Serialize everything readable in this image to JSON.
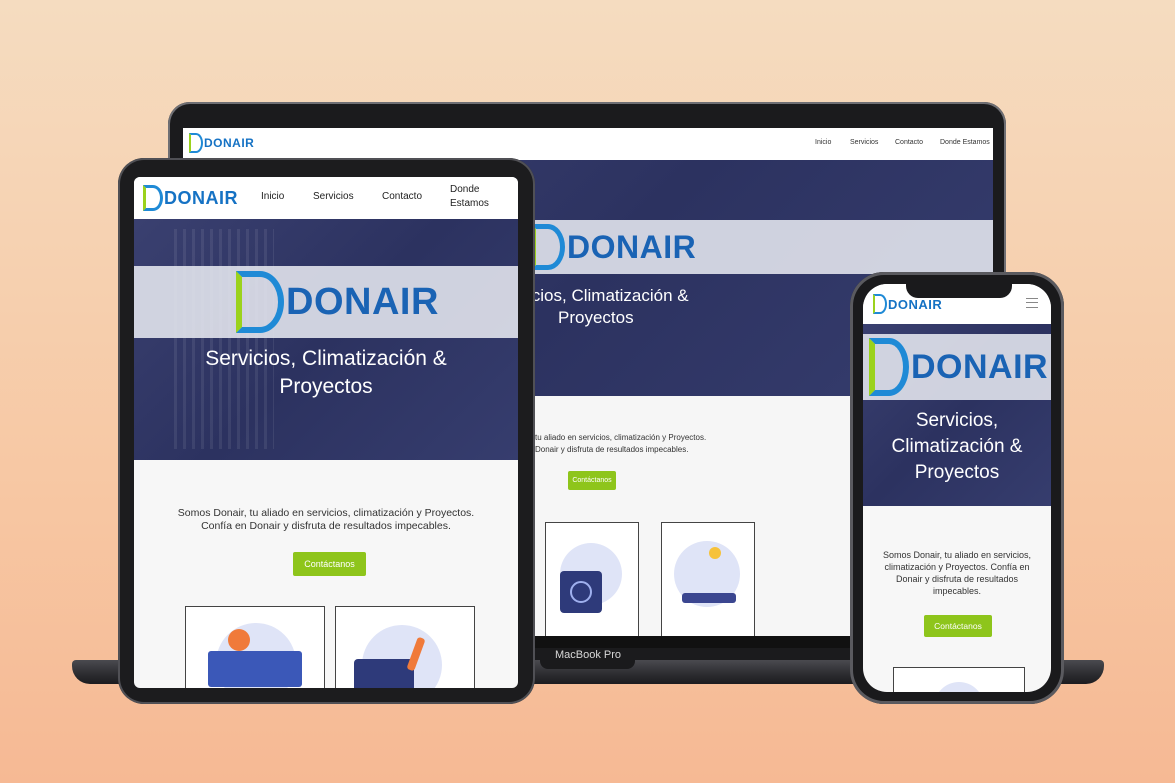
{
  "site": {
    "brand": "DONAIR",
    "tagline": "Servicios, Climatización & Proyectos",
    "tagline_line1": "Servicios, Climatización &",
    "tagline_line2": "Proyectos",
    "nav": {
      "inicio": "Inicio",
      "servicios": "Servicios",
      "contacto": "Contacto",
      "donde": "Donde Estamos",
      "donde_line1": "Donde",
      "donde_line2": "Estamos"
    },
    "intro_line1": "Somos Donair, tu aliado en servicios, climatización y Proyectos.",
    "intro_line2": "Confía en Donair y disfruta de resultados impecables.",
    "cta": "Contáctanos"
  },
  "laptop": {
    "hero_title_line1": "icios, Climatización &",
    "hero_title_line2": "Proyectos",
    "intro_line1": "tu aliado en servicios, climatización y Proyectos.",
    "intro_line2": "Donair y disfruta de resultados impecables.",
    "model_label": "MacBook Pro"
  },
  "phone": {
    "title_line1": "Servicios,",
    "title_line2": "Climatización &",
    "title_line3": "Proyectos",
    "intro_line1": "Somos Donair, tu aliado en servicios,",
    "intro_line2": "climatización y Proyectos. Confía en",
    "intro_line3": "Donair y disfruta de resultados",
    "intro_line4": "impecables."
  },
  "colors": {
    "accent_green": "#8ec51b",
    "brand_blue": "#1572c4",
    "hero_navy": "#2c3260"
  },
  "icons": [
    "menu-icon",
    "fan-unit-illustration",
    "team-meeting-illustration",
    "gear-wrench-illustration"
  ]
}
